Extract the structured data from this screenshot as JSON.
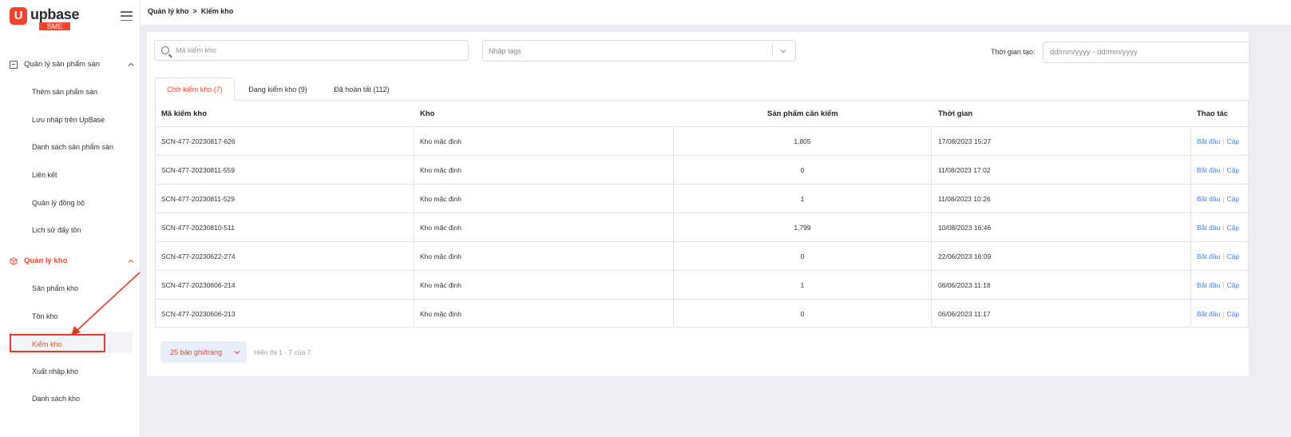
{
  "brand": {
    "logo_letter": "U",
    "name": "upbase",
    "badge": "SME"
  },
  "breadcrumb": {
    "parent": "Quản lý kho",
    "separator": ">",
    "current": "Kiểm kho"
  },
  "sidebar": {
    "group_products": "Quản lý sản phẩm sàn",
    "products_items": [
      "Thêm sản phẩm sàn",
      "Lưu nháp trên UpBase",
      "Danh sách sản phẩm sàn",
      "Liên kết",
      "Quản lý đồng bộ",
      "Lịch sử đẩy tồn"
    ],
    "group_warehouse": "Quản lý kho",
    "warehouse_items": [
      "Sản phẩm kho",
      "Tồn kho",
      "Kiểm kho",
      "Xuất nhập kho",
      "Danh sách kho"
    ]
  },
  "filters": {
    "search_placeholder": "Mã kiểm kho",
    "tags_placeholder": "Nhập tags",
    "time_label": "Thời gian tạo:",
    "date_placeholder": "dd/mm/yyyy - dd/mm/yyyy"
  },
  "tabs": [
    "Chờ kiểm kho (7)",
    "Đang kiểm kho (9)",
    "Đã hoàn tất (112)"
  ],
  "table": {
    "headers": [
      "Mã kiểm kho",
      "Kho",
      "Sản phẩm cần kiểm",
      "Thời gian",
      "Thao tác"
    ],
    "rows": [
      [
        "SCN-477-20230817-626",
        "Kho mặc định",
        "1,805",
        "17/08/2023 15:27"
      ],
      [
        "SCN-477-20230811-559",
        "Kho mặc định",
        "0",
        "11/08/2023 17:02"
      ],
      [
        "SCN-477-20230811-529",
        "Kho mặc định",
        "1",
        "11/08/2023 10:26"
      ],
      [
        "SCN-477-20230810-511",
        "Kho mặc định",
        "1,799",
        "10/08/2023 16:46"
      ],
      [
        "SCN-477-20230622-274",
        "Kho mặc định",
        "0",
        "22/06/2023 16:09"
      ],
      [
        "SCN-477-20230606-214",
        "Kho mặc định",
        "1",
        "06/06/2023 11:18"
      ],
      [
        "SCN-477-20230606-213",
        "Kho mặc định",
        "0",
        "06/06/2023 11:17"
      ]
    ],
    "action_start": "Bắt đầu",
    "action_update": "Cập"
  },
  "pagination": {
    "per_page": "25 bản ghi/trang",
    "info": "Hiển thị 1 - 7 của 7"
  },
  "colors": {
    "accent": "#f5432d",
    "link": "#3b82f6",
    "annotation": "#e53a26"
  }
}
